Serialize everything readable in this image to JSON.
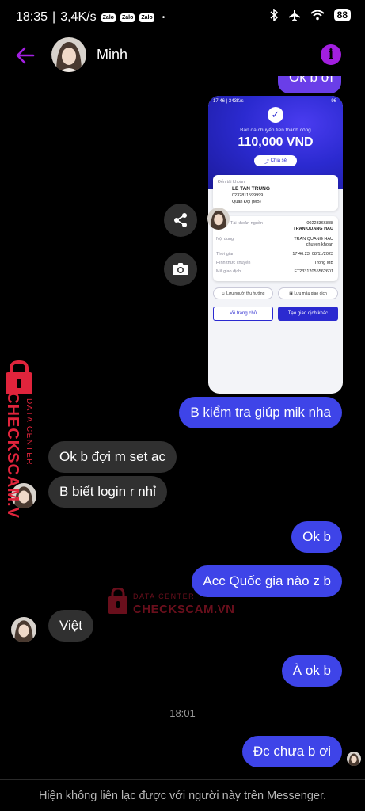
{
  "status_bar": {
    "time": "18:35",
    "network_speed": "3,4K/s",
    "app_badges": [
      "Zalo",
      "Zalo",
      "Zalo"
    ],
    "battery": "88"
  },
  "header": {
    "contact_name": "Minh"
  },
  "peek_message": "Ok b ơi",
  "receipt": {
    "status_time": "17:46",
    "status_speed": "343K/s",
    "status_battery": "96",
    "subtitle": "Bạn đã chuyển tiền thành công",
    "amount": "110,000 VND",
    "share_label": "Chia sẻ",
    "to_account_label": "Đến tài khoản",
    "recipient_name": "LE TAN TRUNG",
    "recipient_account": "0232811599999",
    "recipient_bank": "Quân Đội (MB)",
    "source_label": "Tài khoản nguồn",
    "source_account": "00223366888",
    "source_name": "TRAN QUANG HAU",
    "content_label": "Nội dung",
    "content_value_1": "TRAN QUANG HAU",
    "content_value_2": "chuyen khoan",
    "time_label": "Thời gian",
    "time_value": "17:46:23, 08/11/2023",
    "method_label": "Hình thức chuyển",
    "method_value": "Trong MB",
    "txn_label": "Mã giao dịch",
    "txn_value": "FT23312055562601",
    "save_beneficiary": "Lưu người thụ hưởng",
    "save_template": "Lưu mẫu giao dịch",
    "home_button": "Về trang chủ",
    "new_txn_button": "Tạo giao dịch khác"
  },
  "messages": [
    {
      "id": "m1",
      "direction": "out",
      "text": "B kiểm tra giúp mik nha"
    },
    {
      "id": "m2",
      "direction": "in",
      "text": "Ok b đợi m set ac"
    },
    {
      "id": "m3",
      "direction": "in",
      "text": "B biết login r nhỉ"
    },
    {
      "id": "m4",
      "direction": "out",
      "text": "Ok b"
    },
    {
      "id": "m5",
      "direction": "out",
      "text": "Acc Quốc gia nào z b"
    },
    {
      "id": "m6",
      "direction": "in",
      "text": "Việt"
    },
    {
      "id": "m7",
      "direction": "out",
      "text": "À ok b"
    },
    {
      "id": "m8",
      "direction": "out",
      "text": "Đc chưa b ơi"
    }
  ],
  "timestamp": "18:01",
  "footer_notice": "Hiện không liên lạc được với người này trên Messenger.",
  "watermark": {
    "line1": "DATA CENTER",
    "line2": "CHECKSCAM.VN"
  },
  "colors": {
    "outgoing_bubble": "#3e44e8",
    "incoming_bubble": "#303030",
    "accent": "#a21fe0",
    "watermark": "#e0243c"
  },
  "icons": {
    "back": "arrow-left-icon",
    "info": "info-icon",
    "share": "share-icon",
    "camera": "camera-icon",
    "lock": "lock-icon"
  }
}
